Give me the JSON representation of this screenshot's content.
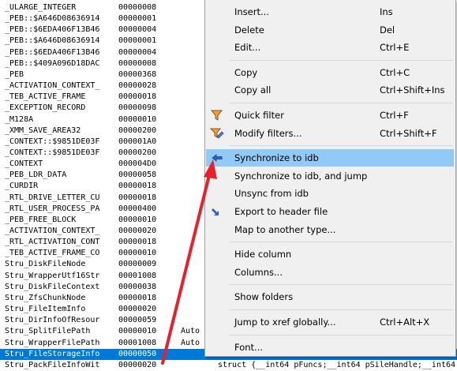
{
  "rows": [
    {
      "name": "_ULARGE_INTEGER",
      "size": "00000008"
    },
    {
      "name": "_PEB::$A646D08636914",
      "size": "00000001"
    },
    {
      "name": "_PEB::$6EDA406F13B46",
      "size": "00000004"
    },
    {
      "name": "_PEB::$A646D08636914",
      "size": "00000001"
    },
    {
      "name": "_PEB::$6EDA406F13B46",
      "size": "00000004"
    },
    {
      "name": "_PEB::$409A096D18DAC",
      "size": "00000008"
    },
    {
      "name": "_PEB",
      "size": "00000368"
    },
    {
      "name": "_ACTIVATION_CONTEXT_",
      "size": "00000028"
    },
    {
      "name": "_TEB_ACTIVE_FRAME",
      "size": "00000018"
    },
    {
      "name": "_EXCEPTION_RECORD",
      "size": "00000098"
    },
    {
      "name": "_M128A",
      "size": "00000010"
    },
    {
      "name": "_XMM_SAVE_AREA32",
      "size": "00000200"
    },
    {
      "name": "_CONTEXT::$9851DE03F",
      "size": "000001A0"
    },
    {
      "name": "_CONTEXT::$9851DE03F",
      "size": "00000200"
    },
    {
      "name": "_CONTEXT",
      "size": "000004D0"
    },
    {
      "name": "_PEB_LDR_DATA",
      "size": "00000058"
    },
    {
      "name": "_CURDIR",
      "size": "00000018"
    },
    {
      "name": "_RTL_DRIVE_LETTER_CU",
      "size": "00000018"
    },
    {
      "name": "_RTL_USER_PROCESS_PA",
      "size": "00000400"
    },
    {
      "name": "_PEB_FREE_BLOCK",
      "size": "00000010"
    },
    {
      "name": "_ACTIVATION_CONTEXT_",
      "size": "00000020"
    },
    {
      "name": "_RTL_ACTIVATION_CONT",
      "size": "00000018"
    },
    {
      "name": "_TEB_ACTIVE_FRAME_CO",
      "size": "00000010"
    },
    {
      "name": "Stru_DiskFileNode",
      "size": "00000009"
    },
    {
      "name": "Stru_WrapperUtf16Str",
      "size": "00001008"
    },
    {
      "name": "Stru_DiskFileContext",
      "size": "00000038"
    },
    {
      "name": "Stru_ZfsChunkNode",
      "size": "00000018"
    },
    {
      "name": "Stru_FileItemInfo",
      "size": "00000020"
    },
    {
      "name": "Stru_DirInfoOfResour",
      "size": "00000059"
    },
    {
      "name": "Stru_SplitFilePath",
      "size": "00000010",
      "sync": "Auto"
    },
    {
      "name": "Stru_WrapperFilePath",
      "size": "00001008",
      "sync": "Auto"
    },
    {
      "name": "Stru_FileStorageInfo",
      "size": "00000050",
      "selected": true
    },
    {
      "name": "Stru_PackFileInfoWit",
      "size": "00000020",
      "decl": "struct {__int64 pFuncs;__int64 pSileHandle;__int64"
    }
  ],
  "menu": {
    "items": [
      {
        "id": "insert",
        "label": "Insert...",
        "shortcut": "Ins"
      },
      {
        "id": "delete",
        "label": "Delete",
        "shortcut": "Del"
      },
      {
        "id": "edit",
        "label": "Edit...",
        "shortcut": "Ctrl+E"
      },
      {
        "sep": true
      },
      {
        "id": "copy",
        "label": "Copy",
        "shortcut": "Ctrl+C"
      },
      {
        "id": "copy-all",
        "label": "Copy all",
        "shortcut": "Ctrl+Shift+Ins"
      },
      {
        "sep": true
      },
      {
        "id": "quick-filter",
        "label": "Quick filter",
        "shortcut": "Ctrl+F",
        "icon": "funnel-icon"
      },
      {
        "id": "modify-filters",
        "label": "Modify filters...",
        "shortcut": "Ctrl+Shift+F",
        "icon": "funnel-edit-icon"
      },
      {
        "sep": true
      },
      {
        "id": "synchronize-to-idb",
        "label": "Synchronize to idb",
        "shortcut": "",
        "icon": "sync-arrow-icon",
        "highlighted": true
      },
      {
        "id": "synchronize-and-jump",
        "label": "Synchronize to idb, and jump",
        "shortcut": ""
      },
      {
        "id": "unsync-from-idb",
        "label": "Unsync from idb",
        "shortcut": ""
      },
      {
        "id": "export-to-header",
        "label": "Export to header file",
        "shortcut": "",
        "icon": "export-arrow-icon"
      },
      {
        "id": "map-to-another-type",
        "label": "Map to another type...",
        "shortcut": ""
      },
      {
        "sep": true
      },
      {
        "id": "hide-column",
        "label": "Hide column",
        "shortcut": ""
      },
      {
        "id": "columns",
        "label": "Columns...",
        "shortcut": ""
      },
      {
        "sep": true
      },
      {
        "id": "show-folders",
        "label": "Show folders",
        "shortcut": ""
      },
      {
        "sep": true
      },
      {
        "id": "jump-to-xref-globally",
        "label": "Jump to xref globally...",
        "shortcut": "Ctrl+Alt+X"
      },
      {
        "sep": true
      },
      {
        "id": "font",
        "label": "Font...",
        "shortcut": ""
      }
    ]
  },
  "colors": {
    "selection": "#0078d7",
    "highlight": "#91c9f7",
    "arrow": "#e8202a",
    "menu_bg": "#f0f0f0"
  }
}
